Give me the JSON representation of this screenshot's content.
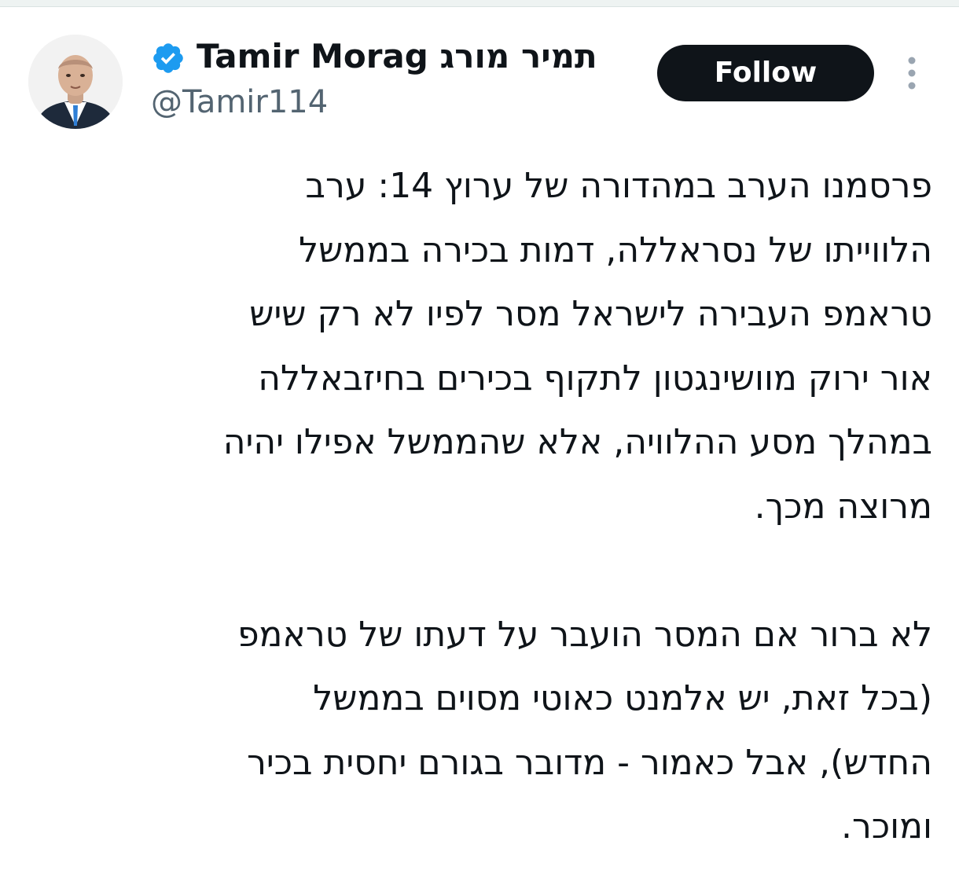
{
  "author": {
    "display_name": "Tamir Morag תמיר מורג",
    "handle": "@Tamir114",
    "verified_icon": "verified-badge-icon",
    "avatar_icon": "profile-photo"
  },
  "actions": {
    "follow_label": "Follow",
    "more_icon": "more-vertical-icon"
  },
  "tweet": {
    "paragraph_1": [
      "פרסמנו הערב במהדורה של ערוץ 14: ערב",
      "הלווייתו של נסראללה, דמות בכירה בממשל",
      "טראמפ העבירה לישראל מסר לפיו לא רק שיש",
      "אור ירוק מוושינגטון לתקוף בכירים בחיזבאללה",
      "במהלך מסע ההלוויה, אלא שהממשל אפילו יהיה",
      "מרוצה מכך."
    ],
    "paragraph_2": [
      "לא ברור אם המסר הועבר על דעתו של טראמפ",
      "(בכל זאת, יש אלמנט כאוטי מסוים בממשל",
      "החדש), אבל כאמור - מדובר בגורם יחסית בכיר",
      "ומוכר."
    ]
  },
  "colors": {
    "text": "#0f1419",
    "secondary_text": "#536471",
    "verified_blue": "#1d9bf0",
    "button_bg": "#0f1419",
    "button_text": "#ffffff"
  }
}
